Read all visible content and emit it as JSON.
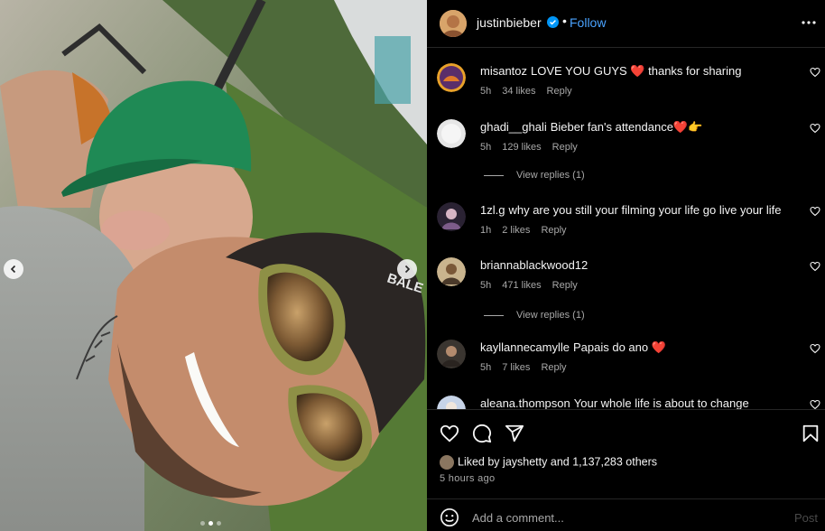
{
  "post": {
    "username": "justinbieber",
    "follow_label": "Follow",
    "separator": "•",
    "verified": true,
    "accent": "#0095f6"
  },
  "carousel": {
    "slides": 3,
    "active_index": 1
  },
  "comments": [
    {
      "user": "misantoz",
      "text": "LOVE YOU GUYS ❤️ thanks for sharing",
      "time": "5h",
      "likes": "34 likes",
      "reply": "Reply"
    },
    {
      "user": "ghadi__ghali",
      "text": "Bieber fan's attendance❤️👉",
      "time": "5h",
      "likes": "129 likes",
      "reply": "Reply",
      "view_replies": "View replies (1)"
    },
    {
      "user": "1zl.g",
      "text": "why are you still your filming your life go live your life",
      "time": "1h",
      "likes": "2 likes",
      "reply": "Reply"
    },
    {
      "user": "briannablackwood12",
      "text": "",
      "time": "5h",
      "likes": "471 likes",
      "reply": "Reply",
      "view_replies": "View replies (1)"
    },
    {
      "user": "kayllannecamylle",
      "text": "Papais do ano ❤️",
      "time": "5h",
      "likes": "7 likes",
      "reply": "Reply"
    },
    {
      "user": "aleana.thompson",
      "text": "Your whole life is about to change",
      "time": "",
      "likes": "",
      "reply": ""
    }
  ],
  "likes": {
    "prefix": "Liked by",
    "user": "jayshetty",
    "joiner": "and",
    "count": "1,137,283 others"
  },
  "time_ago": "5 hours ago",
  "add_comment": {
    "placeholder": "Add a comment...",
    "post_label": "Post"
  },
  "icons": {
    "carousel_prev": "chevron-left-icon",
    "carousel_next": "chevron-right-icon",
    "verified": "verified-badge-icon",
    "more": "more-horizontal-icon",
    "comment_like": "heart-outline-icon",
    "like": "heart-outline-icon",
    "comment": "comment-bubble-icon",
    "share": "paper-plane-icon",
    "save": "bookmark-icon",
    "emoji": "smiley-icon"
  }
}
